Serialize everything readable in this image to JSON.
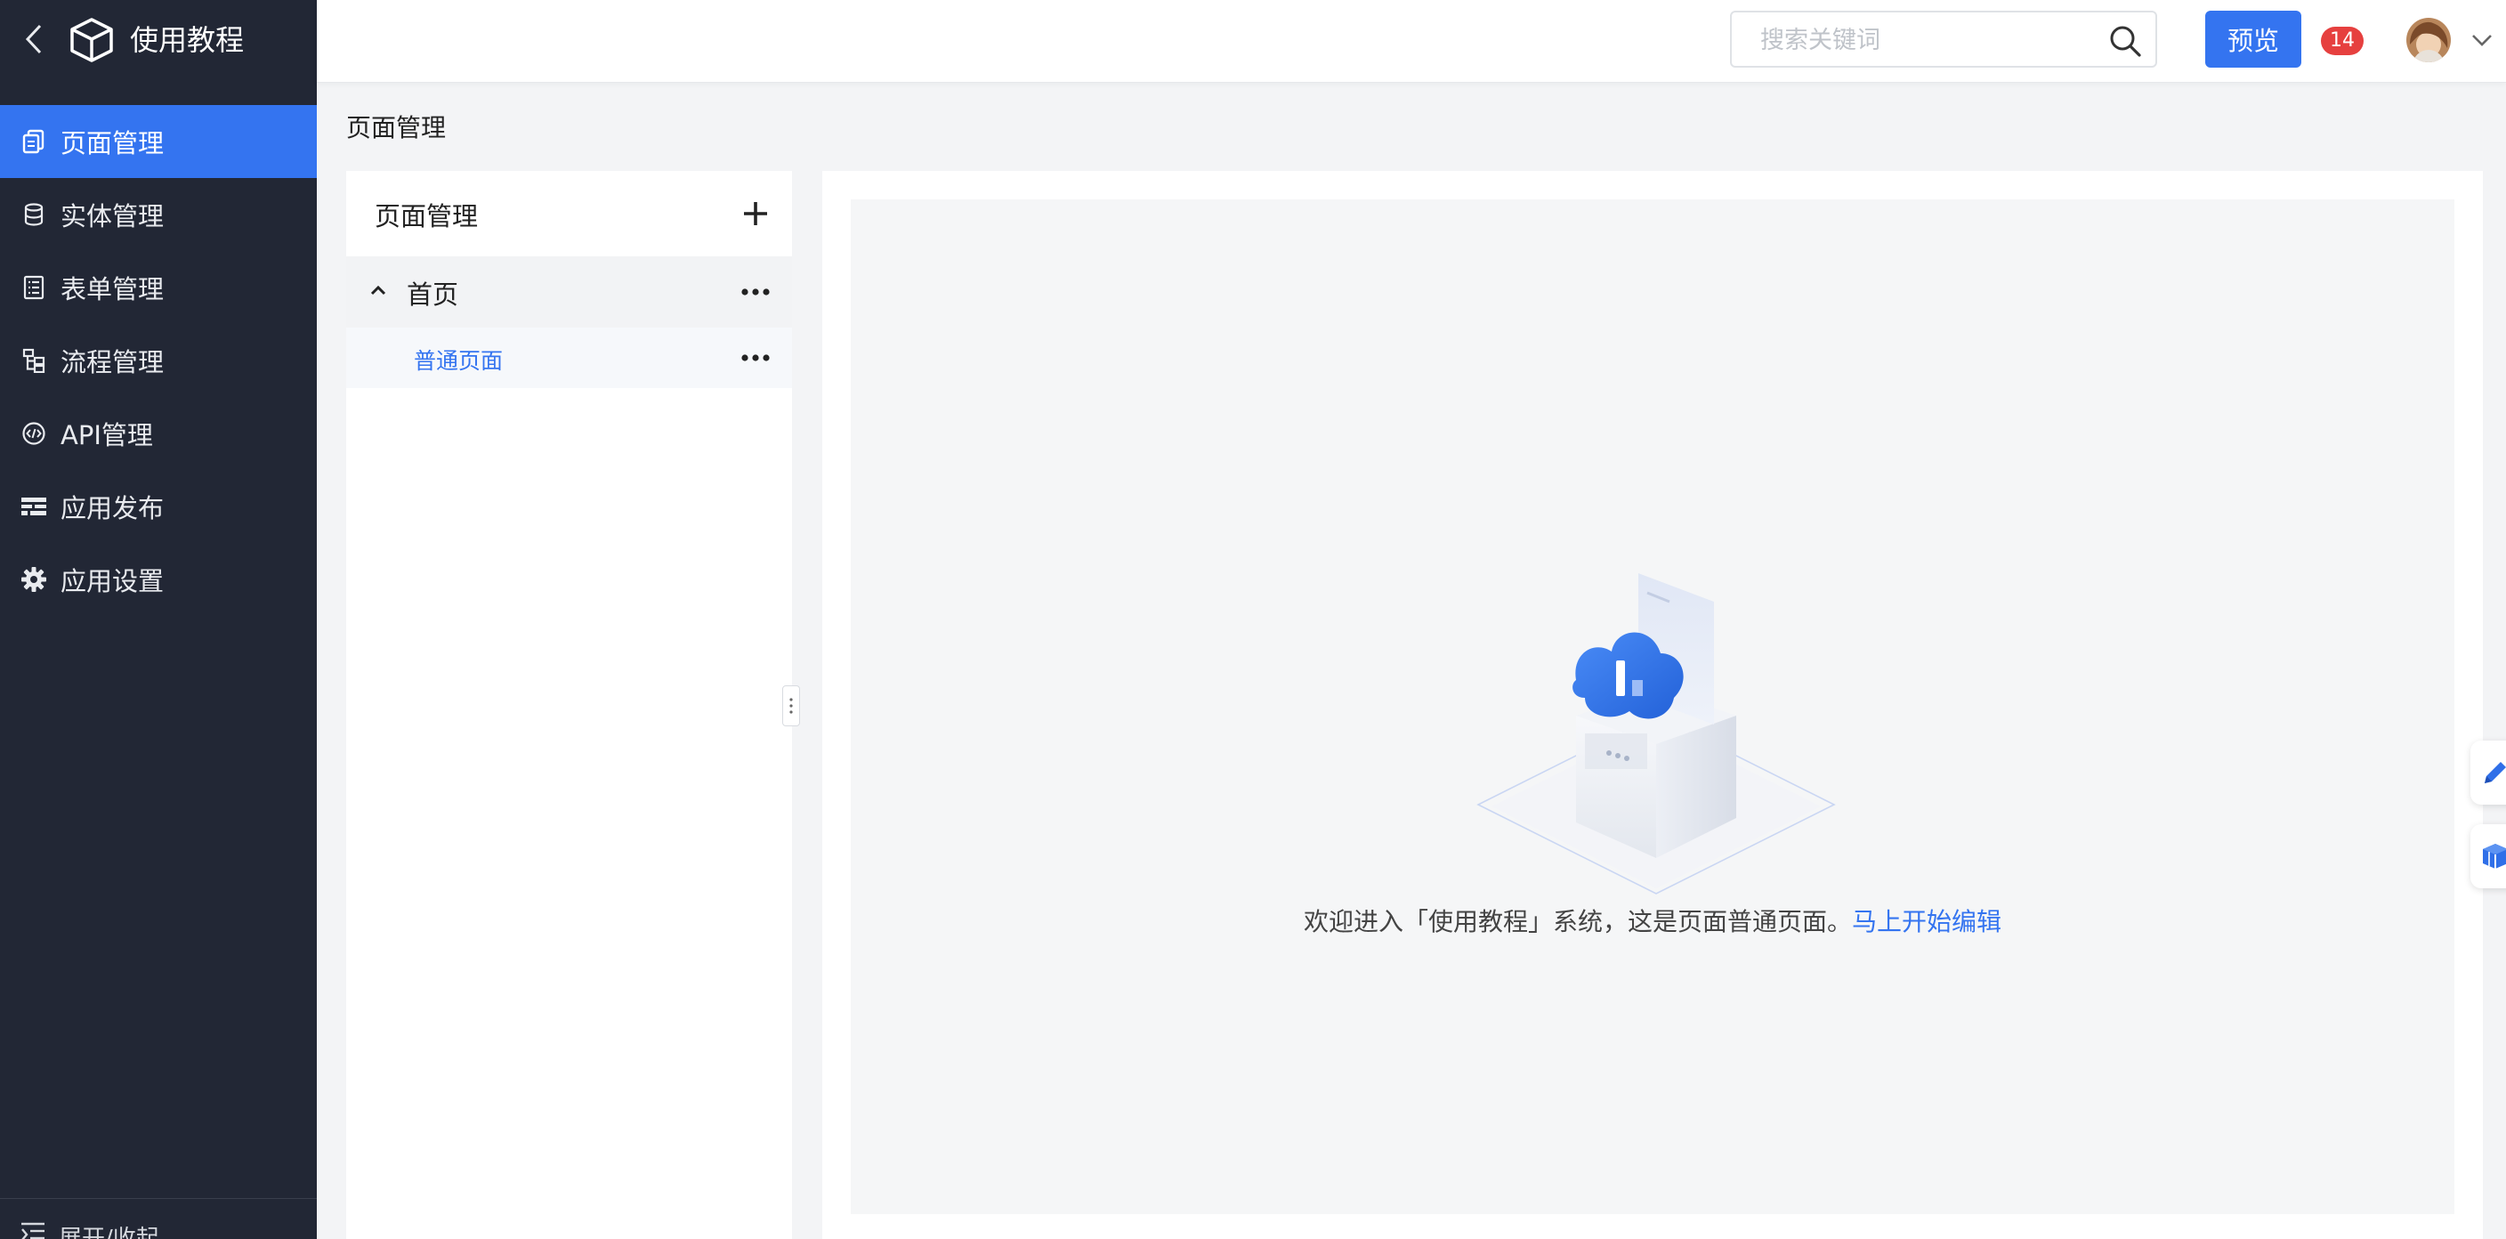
{
  "app": {
    "title": "使用教程"
  },
  "sidebar": {
    "items": [
      {
        "label": "页面管理",
        "icon": "pages-icon",
        "active": true
      },
      {
        "label": "实体管理",
        "icon": "database-icon",
        "active": false
      },
      {
        "label": "表单管理",
        "icon": "form-icon",
        "active": false
      },
      {
        "label": "流程管理",
        "icon": "flow-icon",
        "active": false
      },
      {
        "label": "API管理",
        "icon": "api-icon",
        "active": false
      },
      {
        "label": "应用发布",
        "icon": "publish-icon",
        "active": false
      },
      {
        "label": "应用设置",
        "icon": "gear-icon",
        "active": false
      }
    ],
    "bottom_label": "展开/收起"
  },
  "header": {
    "search_placeholder": "搜索关键词",
    "preview_label": "预览",
    "notification_count": "14"
  },
  "page": {
    "title": "页面管理"
  },
  "tree": {
    "title": "页面管理",
    "nodes": [
      {
        "label": "首页",
        "expanded": true,
        "children": [
          {
            "label": "普通页面",
            "selected": true
          }
        ]
      }
    ]
  },
  "main": {
    "welcome_text": "欢迎进入「使用教程」系统，这是页面普通页面。",
    "edit_link": "马上开始编辑"
  },
  "colors": {
    "accent": "#3474f0",
    "sidebar_bg": "#222735",
    "badge": "#e6403f"
  }
}
